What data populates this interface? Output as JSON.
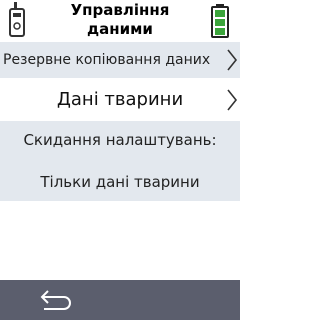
{
  "header": {
    "title_line1": "Управління",
    "title_line2": "даними"
  },
  "menu": {
    "backup_label": "Резервне копіювання даних",
    "animal_data_label": "Дані тварини"
  },
  "reset": {
    "label": "Скидання налаштувань:",
    "value": "Тільки дані тварини"
  },
  "icons": {
    "device": "collar-device-icon",
    "battery": "battery-icon",
    "chevron": "chevron-right-icon",
    "back": "back-arrow-icon"
  },
  "battery_level": 1.0,
  "colors": {
    "row_background": "#e3e8ee",
    "bottom_bar": "#5b5e6d",
    "battery_green": "#3aa43a"
  }
}
